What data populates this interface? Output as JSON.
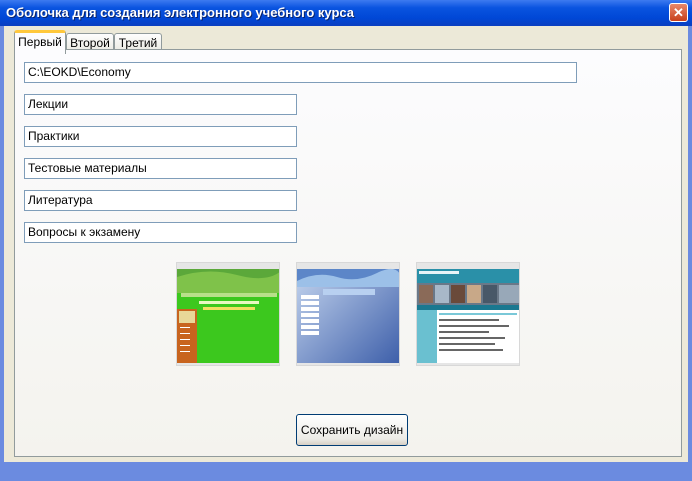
{
  "window": {
    "title": "Оболочка для создания электронного учебного курса"
  },
  "tabs": [
    {
      "label": "Первый"
    },
    {
      "label": "Второй"
    },
    {
      "label": "Третий"
    }
  ],
  "fields": {
    "path": "C:\\EOKD\\Economy",
    "lectures": "Лекции",
    "practices": "Практики",
    "tests": "Тестовые материалы",
    "literature": "Литература",
    "exam_questions": "Вопросы к экзамену"
  },
  "thumbnails": [
    {
      "name": "green design preview"
    },
    {
      "name": "blue design preview"
    },
    {
      "name": "photo design preview"
    }
  ],
  "buttons": {
    "save": "Сохранить дизайн"
  },
  "colors": {
    "titlebar": "#0A54E0",
    "accent_tab": "#FFC83C",
    "border": "#919B9C"
  }
}
